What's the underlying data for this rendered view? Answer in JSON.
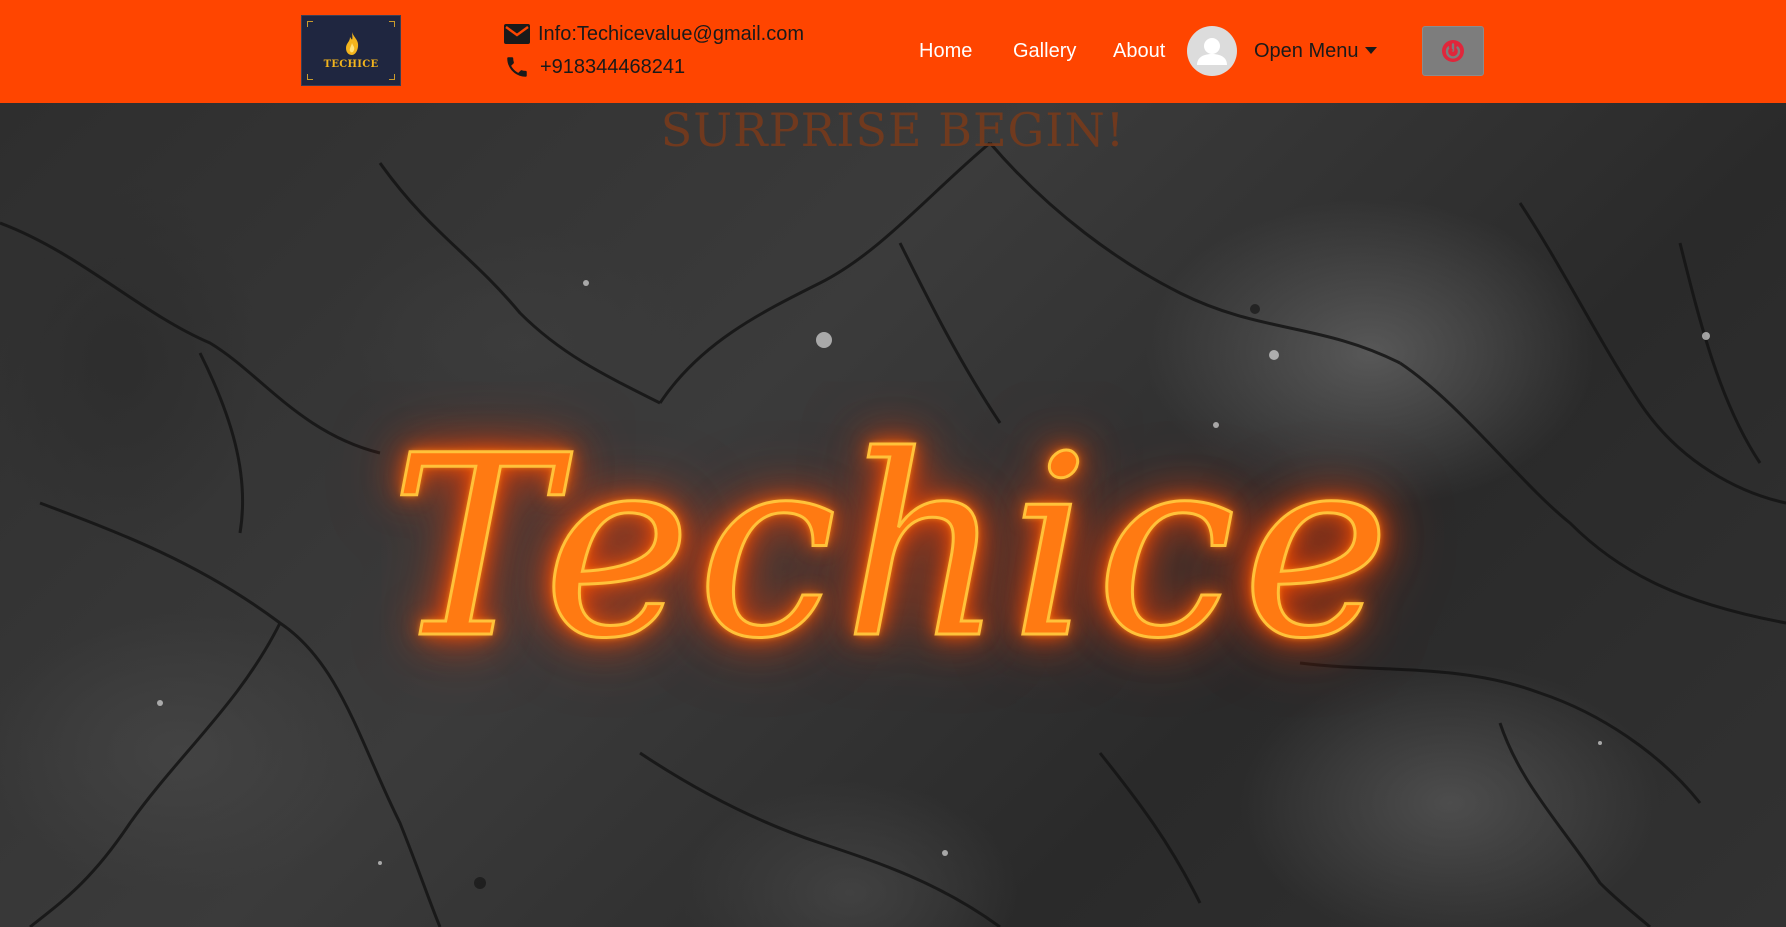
{
  "header": {
    "logo": {
      "brand": "TECHICE"
    },
    "contact": {
      "email": "Info:Techicevalue@gmail.com",
      "phone": "+918344468241"
    },
    "nav": {
      "home": "Home",
      "gallery": "Gallery",
      "about": "About"
    },
    "menu_toggle": "Open Menu",
    "icons": {
      "email": "mail-icon",
      "phone": "phone-icon",
      "avatar": "user-avatar-icon",
      "logout": "power-icon"
    },
    "colors": {
      "header_bg": "#ff4500",
      "logout_bg": "#7d7d7d",
      "logout_icon": "#e0263b"
    }
  },
  "hero": {
    "tagline": "SURPRISE BEGIN!",
    "title": "Techice"
  }
}
